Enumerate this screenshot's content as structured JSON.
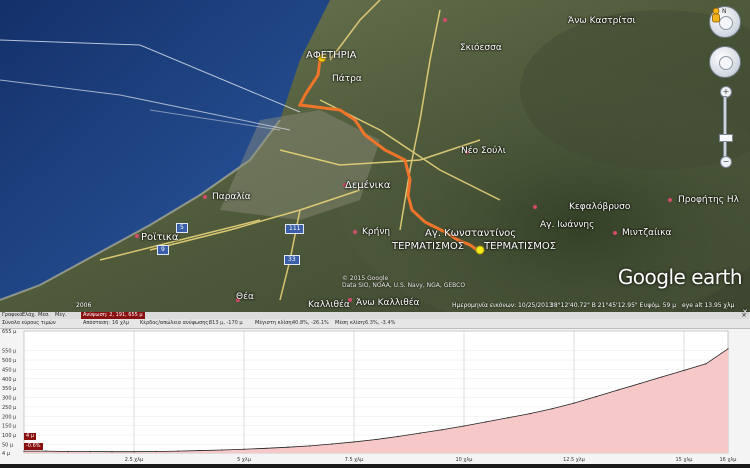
{
  "map": {
    "places": [
      {
        "id": "afetiria",
        "label": "ΑΦΕΤΗΡΙΑ"
      },
      {
        "id": "patra",
        "label": "Πάτρα"
      },
      {
        "id": "skioessa",
        "label": "Σκιόεσσα"
      },
      {
        "id": "ano_kastritsi",
        "label": "Άνω Καστρίτσι"
      },
      {
        "id": "neo_souli",
        "label": "Νέο Σούλι"
      },
      {
        "id": "demenika",
        "label": "Δεμένικα"
      },
      {
        "id": "paralia",
        "label": "Παραλία"
      },
      {
        "id": "rovitika",
        "label": "Ροϊτικα"
      },
      {
        "id": "krini",
        "label": "Κρήνη"
      },
      {
        "id": "ag_konstantinos",
        "label": "Αγ. Κωνσταντίνος"
      },
      {
        "id": "kefalovryso",
        "label": "Κεφαλόβρυσο"
      },
      {
        "id": "ag_ioannis",
        "label": "Αγ. Ιωάννης"
      },
      {
        "id": "mintzaika",
        "label": "Μιντζαίικα"
      },
      {
        "id": "profitis_ilias",
        "label": "Προφήτης Ηλ"
      },
      {
        "id": "thea",
        "label": "Θέα"
      },
      {
        "id": "kallithea",
        "label": "Καλλιθέα"
      },
      {
        "id": "ano_kallithea",
        "label": "Άνω Καλλιθέα"
      },
      {
        "id": "termatismos1",
        "label": "ΤΕΡΜΑΤΙΣΜΟΣ"
      },
      {
        "id": "termatismos2",
        "label": "ΤΕΡΜΑΤΙΣΜΟΣ"
      }
    ],
    "road_shields": [
      "5",
      "9",
      "111",
      "33"
    ],
    "attribution": {
      "line1": "© 2015 Google",
      "line2": "Data SIO, NOAA, U.S. Navy, NGA, GEBCO"
    },
    "logo": {
      "main": "Google earth"
    },
    "status": {
      "year": "2006",
      "imagery_date": "Ημερομηνία εικόνων: 10/25/2013",
      "coords": "38°12'40.72\" Β 21°45'12.95\" Ε",
      "elev": "υψόμ. 59 μ",
      "eye_alt": "eye alt 13.95 χλμ"
    },
    "colors": {
      "track": "#f0752a",
      "sea": "#1f3f7a",
      "roads": "#e9d37a"
    }
  },
  "profile": {
    "header": {
      "graph_label": "Γραφικό:",
      "min": "Ελάχ.",
      "avg": "Μέσ.",
      "max": "Μέγ.",
      "altitude_label": "Ανύψωση:",
      "altitude_value": "2, 191, 655 μ"
    },
    "stats": {
      "summary_label": "Σύνολο εύρους τιμών",
      "distance_label": "Απόσταση:",
      "distance_value": "16 χλμ",
      "gain_label": "Κέρδος/απώλεια ανύψωσης:",
      "gain_value": "813 μ, -170 μ",
      "max_slope_label": "Μέγιστη κλίση:",
      "max_slope_value": "40.8%, -26.1%",
      "avg_slope_label": "Μέση κλίση:",
      "avg_slope_value": "6.3%, -3.4%"
    },
    "badges": {
      "start_elev": "4 μ",
      "start_slope": "-0.6%"
    }
  },
  "chart_data": {
    "type": "area",
    "title": "",
    "xlabel": "",
    "ylabel": "",
    "x_ticks": [
      "2.5 χλμ",
      "5 χλμ",
      "7.5 χλμ",
      "10 χλμ",
      "12.5 χλμ",
      "15 χλμ",
      "16 χλμ"
    ],
    "y_ticks": [
      "4 μ",
      "50 μ",
      "100 μ",
      "150 μ",
      "200 μ",
      "250 μ",
      "300 μ",
      "350 μ",
      "400 μ",
      "450 μ",
      "500 μ",
      "550 μ",
      "655 μ"
    ],
    "xlim": [
      0,
      16
    ],
    "ylim": [
      4,
      655
    ],
    "grid": true,
    "series": [
      {
        "x": [
          0,
          0.5,
          1,
          1.5,
          2,
          2.5,
          3,
          3.5,
          4,
          4.5,
          5,
          5.5,
          6,
          6.5,
          7,
          7.5,
          8,
          8.5,
          9,
          9.5,
          10,
          10.5,
          11,
          11.5,
          12,
          12.5,
          13,
          13.5,
          14,
          14.5,
          15,
          15.5,
          16
        ],
        "y": [
          14,
          14,
          12,
          12,
          11,
          11,
          12,
          14,
          17,
          20,
          24,
          29,
          35,
          42,
          52,
          63,
          76,
          92,
          110,
          128,
          148,
          170,
          192,
          214,
          240,
          270,
          305,
          340,
          375,
          410,
          445,
          480,
          560
        ]
      }
    ],
    "colors": {
      "fill": "#f6c8c8",
      "line": "#222222",
      "grid": "#bcbcbc",
      "bg": "#ffffff"
    }
  }
}
